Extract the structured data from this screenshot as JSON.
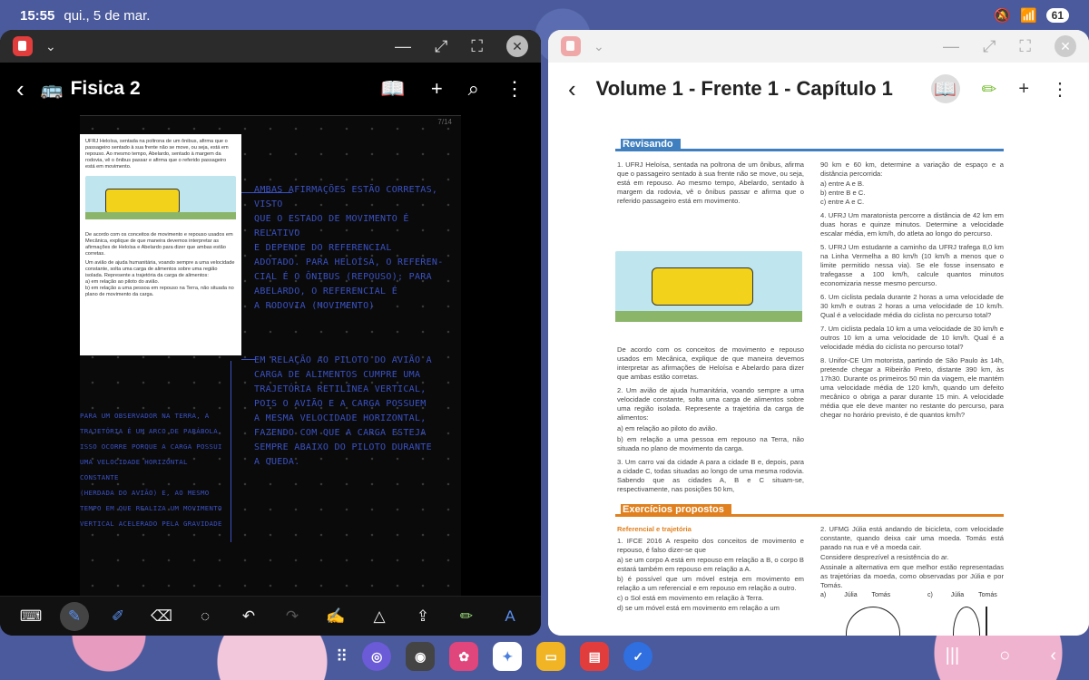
{
  "status": {
    "time": "15:55",
    "date": "qui., 5 de mar.",
    "battery": "61"
  },
  "left": {
    "title": "Fisica 2",
    "title_icon": "🚌",
    "page_indicator": "7/14",
    "sheet": {
      "q1": "UFRJ Heloísa, sentada na poltrona de um ônibus, afirma que o passageiro sentado à sua frente não se move, ou seja, está em repouso. Ao mesmo tempo, Abelardo, sentado à margem da rodovia, vê o ônibus passar e afirma que o referido passageiro está em movimento.",
      "q1b": "De acordo com os conceitos de movimento e repouso usados em Mecânica, explique de que maneira devemos interpretar as afirmações de Heloísa e Abelardo para dizer que ambas estão corretas.",
      "q2": "Um avião de ajuda humanitária, voando sempre a uma velocidade constante, solta uma carga de alimentos sobre uma região isolada. Represente a trajetória da carga de alimentos:",
      "q2a": "a)  em relação ao piloto do avião.",
      "q2b": "b)  em relação a uma pessoa em repouso na Terra, não situada no plano de movimento da carga."
    },
    "notes": [
      "AMBAS AFIRMAÇÕES ESTÃO CORRETAS, VISTO",
      "QUE O ESTADO DE MOVIMENTO É RELATIVO",
      "E DEPENDE DO REFERENCIAL",
      "ADOTADO. PARA HELOÍSA, O REFEREN-",
      "CIAL É O ÔNIBUS (REPOUSO); PARA",
      "ABELARDO, O REFERENCIAL É",
      "A RODOVIA (MOVIMENTO)"
    ],
    "notes2": [
      "EM RELAÇÃO AO PILOTO DO AVIÃO A",
      "CARGA DE ALIMENTOS CUMPRE UMA",
      "TRAJETÓRIA RETILÍNEA VERTICAL,",
      "POIS O AVIÃO E A CARGA POSSUEM",
      "A MESMA VELOCIDADE HORIZONTAL,",
      "FAZENDO COM QUE A CARGA ESTEJA",
      "SEMPRE ABAIXO DO PILOTO DURANTE",
      "A QUEDA."
    ],
    "notes3": [
      "PARA UM OBSERVADOR NA TERRA, A",
      "TRAJETÓRIA É UM ARCO DE PARÁBOLA.",
      "ISSO OCORRE PORQUE A CARGA POSSUI",
      "UMA VELOCIDADE HORIZONTAL CONSTANTE",
      "(HERDADA DO AVIÃO) E, AO MESMO",
      "TEMPO EM QUE REALIZA UM MOVIMENTO",
      "VERTICAL ACELERADO PELA GRAVIDADE"
    ]
  },
  "right": {
    "title": "Volume 1 - Frente 1 - Capítulo 1",
    "section1": "Revisando",
    "section2": "Exercícios propostos",
    "c1": [
      "1. UFRJ Heloísa, sentada na poltrona de um ônibus, afirma que o passageiro sentado à sua frente não se move, ou seja, está em repouso. Ao mesmo tempo, Abelardo, sentado à margem da rodovia, vê o ônibus passar e afirma que o referido passageiro está em movimento."
    ],
    "c1b": [
      "De acordo com os conceitos de movimento e repouso usados em Mecânica, explique de que maneira devemos interpretar as afirmações de Heloísa e Abelardo para dizer que ambas estão corretas.",
      "2. Um avião de ajuda humanitária, voando sempre a uma velocidade constante, solta uma carga de alimentos sobre uma região isolada. Represente a trajetória da carga de alimentos:",
      "a)  em relação ao piloto do avião.",
      "b)  em relação a uma pessoa em repouso na Terra, não situada no plano de movimento da carga.",
      "3. Um carro vai da cidade A para a cidade B e, depois, para a cidade C, todas situadas ao longo de uma mesma rodovia. Sabendo que as cidades A, B e C situam-se, respectivamente, nas posições 50 km,"
    ],
    "c2": [
      "90 km e 60 km, determine a variação de espaço e a distância percorrida:",
      "a)  entre A e B.",
      "b)  entre B e C.",
      "c)  entre A e C.",
      "4. UFRJ Um maratonista percorre a distância de 42 km em duas horas e quinze minutos. Determine a velocidade escalar média, em km/h, do atleta ao longo do percurso.",
      "5. UFRJ Um estudante a caminho da UFRJ trafega 8,0 km na Linha Vermelha a 80 km/h (10 km/h a menos que o limite permitido nessa via). Se ele fosse insensato e trafegasse a 100 km/h, calcule quantos minutos economizaria nesse mesmo percurso.",
      "6. Um ciclista pedala durante 2 horas a uma velocidade de 30 km/h e outras 2 horas a uma velocidade de 10 km/h. Qual é a velocidade média do ciclista no percurso total?",
      "7. Um ciclista pedala 10 km a uma velocidade de 30 km/h e outros 10 km a uma velocidade de 10 km/h. Qual é a velocidade média do ciclista no percurso total?",
      "8. Unifor-CE Um motorista, partindo de São Paulo às 14h, pretende chegar a Ribeirão Preto, distante 390 km, às 17h30. Durante os primeiros 50 min da viagem, ele mantém uma velocidade média de 120 km/h, quando um defeito mecânico o obriga a parar durante 15 min. A velocidade média que ele deve manter no restante do percurso, para chegar no horário previsto, é de quantos km/h?"
    ],
    "e1": [
      "Referencial e trajetória",
      "1. IFCE 2016 A respeito dos conceitos de movimento e repouso, é falso dizer-se que",
      "a)  se um corpo A está em repouso em relação a B, o corpo B estará também em repouso em relação a A.",
      "b)  é possível que um móvel esteja em movimento em relação a um referencial e em repouso em relação a outro.",
      "c)  o Sol está em movimento em relação à Terra.",
      "d)  se um móvel está em movimento em relação a um"
    ],
    "e2": [
      "2. UFMG Júlia está andando de bicicleta, com velocidade constante, quando deixa cair uma moeda. Tomás está parado na rua e vê a moeda cair.",
      "Considere desprezível a resistência do ar.",
      "Assinale a alternativa em que melhor estão representadas as trajetórias da moeda, como observadas por Júlia e por Tomás."
    ],
    "fig_labels": {
      "a": "a)",
      "c": "c)",
      "julia": "Júlia",
      "tomas": "Tomás"
    }
  },
  "dock_apps": [
    "Internet",
    "Câmera",
    "Galeria",
    "Gemini",
    "Arquivos",
    "Notes",
    "Tarefas"
  ]
}
